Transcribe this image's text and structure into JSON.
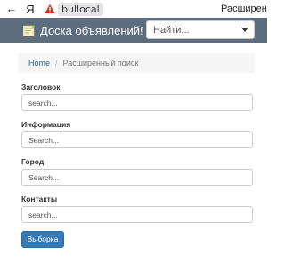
{
  "browser": {
    "back_icon": "arrow-left-icon",
    "back_glyph": "←",
    "yandex_glyph": "Я",
    "yandex_icon": "yandex-logo-icon",
    "warning_icon": "warning-triangle-icon",
    "url": "bullocal",
    "tab_title": "Расширенн"
  },
  "navbar": {
    "brand": "Доска объявлений!",
    "search_placeholder": "Найти...",
    "dropdown_icon": "caret-down-icon",
    "bg_color": "#5d6d7e"
  },
  "breadcrumb": {
    "home": "Home",
    "separator": "/",
    "current": "Расширенный поиск"
  },
  "form": {
    "fields": [
      {
        "label": "Заголовок",
        "placeholder": "search..."
      },
      {
        "label": "Информация",
        "placeholder": "Search..."
      },
      {
        "label": "Город",
        "placeholder": "Search..."
      },
      {
        "label": "Контакты",
        "placeholder": "search..."
      }
    ],
    "submit_label": "Выборка",
    "submit_color": "#337ab7"
  }
}
